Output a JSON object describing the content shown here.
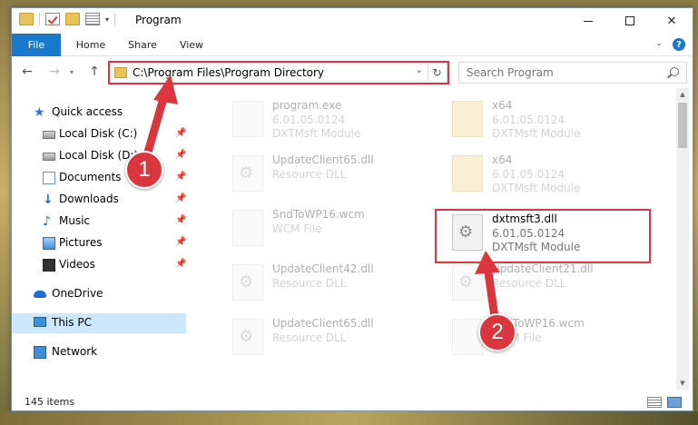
{
  "window": {
    "title": "Program",
    "icons": [
      "folder-icon",
      "properties-icon",
      "new-folder-icon"
    ]
  },
  "ribbon": {
    "tabs": [
      {
        "label": "File"
      },
      {
        "label": "Home"
      },
      {
        "label": "Share"
      },
      {
        "label": "View"
      }
    ]
  },
  "nav": {
    "address": "C:\\Program Files\\Program Directory",
    "search_placeholder": "Search Program"
  },
  "sidebar": {
    "items": [
      {
        "label": "Quick access",
        "icon": "star-icon"
      },
      {
        "label": "Local Disk (C:)",
        "icon": "disk-icon",
        "pinned": true
      },
      {
        "label": "Local Disk (D:)",
        "icon": "disk-icon",
        "pinned": true
      },
      {
        "label": "Documents",
        "icon": "documents-icon",
        "pinned": true
      },
      {
        "label": "Downloads",
        "icon": "download-icon",
        "pinned": true
      },
      {
        "label": "Music",
        "icon": "music-icon",
        "pinned": true
      },
      {
        "label": "Pictures",
        "icon": "pictures-icon",
        "pinned": true
      },
      {
        "label": "Videos",
        "icon": "videos-icon",
        "pinned": true
      },
      {
        "label": "OneDrive",
        "icon": "onedrive-icon"
      },
      {
        "label": "This PC",
        "icon": "computer-icon",
        "selected": true
      },
      {
        "label": "Network",
        "icon": "network-icon"
      }
    ]
  },
  "files": [
    {
      "name": "program.exe",
      "line1": "6.01.05.0124",
      "line2": "DXTMsft Module",
      "kind": "exe",
      "dimmed": true
    },
    {
      "name": "x64",
      "line1": "6.01.05.0124",
      "line2": "DXTMsft Module",
      "kind": "folder",
      "dimmed": true
    },
    {
      "name": "UpdateClient65.dll",
      "line1": "Resource DLL",
      "line2": "",
      "kind": "dll",
      "dimmed": true
    },
    {
      "name": "x64",
      "line1": "6.01.05.0124",
      "line2": "DXTMsft Module",
      "kind": "folder",
      "dimmed": true
    },
    {
      "name": "SndToWP16.wcm",
      "line1": "WCM File",
      "line2": "",
      "kind": "file",
      "dimmed": true
    },
    {
      "name": "dxtmsft3.dll",
      "line1": "6.01.05.0124",
      "line2": "DXTMsft Module",
      "kind": "dll",
      "dimmed": false
    },
    {
      "name": "UpdateClient42.dll",
      "line1": "Resource DLL",
      "line2": "",
      "kind": "dll",
      "dimmed": true
    },
    {
      "name": "UpdateClient21.dll",
      "line1": "Resource DLL",
      "line2": "",
      "kind": "dll",
      "dimmed": true
    },
    {
      "name": "UpdateClient65.dll",
      "line1": "Resource DLL",
      "line2": "",
      "kind": "dll",
      "dimmed": true
    },
    {
      "name": "SndToWP16.wcm",
      "line1": "WCM File",
      "line2": "",
      "kind": "file",
      "dimmed": true
    }
  ],
  "status": {
    "item_count": "145 items"
  },
  "annotations": {
    "step1": "1",
    "step2": "2",
    "highlight_color": "#d9363e"
  }
}
